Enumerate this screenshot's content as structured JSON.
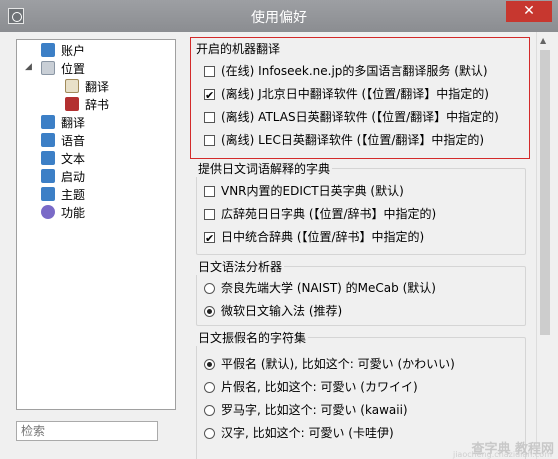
{
  "window": {
    "title": "使用偏好",
    "close": "✕"
  },
  "nav": {
    "items": [
      {
        "label": "账户",
        "icon": "user-icon"
      },
      {
        "label": "位置",
        "icon": "document-icon",
        "expanded": true
      },
      {
        "label": "翻译",
        "icon": "pencil-icon"
      },
      {
        "label": "辞书",
        "icon": "book-icon"
      },
      {
        "label": "翻译",
        "icon": "globe-icon"
      },
      {
        "label": "语音",
        "icon": "music-icon"
      },
      {
        "label": "文本",
        "icon": "text-icon"
      },
      {
        "label": "启动",
        "icon": "play-icon"
      },
      {
        "label": "主题",
        "icon": "palette-icon"
      },
      {
        "label": "功能",
        "icon": "gear-icon"
      }
    ]
  },
  "search": {
    "placeholder": "检索"
  },
  "groups": {
    "machine": {
      "title": "开启的机器翻译",
      "options": [
        {
          "label": "(在线) Infoseek.ne.jp的多国语言翻译服务 (默认)",
          "checked": false
        },
        {
          "label": "(离线) J北京日中翻译软件 (【位置/翻译】中指定的)",
          "checked": true
        },
        {
          "label": "(离线) ATLAS日英翻译软件 (【位置/翻译】中指定的)",
          "checked": false
        },
        {
          "label": "(离线) LEC日英翻译软件 (【位置/翻译】中指定的)",
          "checked": false
        }
      ]
    },
    "dict": {
      "title": "提供日文词语解释的字典",
      "options": [
        {
          "label": "VNR内置的EDICT日英字典 (默认)",
          "checked": false
        },
        {
          "label": "広辞苑日日字典 (【位置/辞书】中指定的)",
          "checked": false
        },
        {
          "label": "日中统合辞典 (【位置/辞书】中指定的)",
          "checked": true
        }
      ]
    },
    "parser": {
      "title": "日文语法分析器",
      "options": [
        {
          "label": "奈良先端大学 (NAIST) 的MeCab (默认)",
          "selected": false
        },
        {
          "label": "微软日文输入法 (推荐)",
          "selected": true
        }
      ]
    },
    "kana": {
      "title": "日文振假名的字符集",
      "options": [
        {
          "label": "平假名 (默认), 比如这个: 可愛い (かわいい)",
          "selected": true
        },
        {
          "label": "片假名, 比如这个: 可愛い (カワイイ)",
          "selected": false
        },
        {
          "label": "罗马字, 比如这个: 可愛い (kawaii)",
          "selected": false
        },
        {
          "label": "汉字, 比如这个: 可愛い (卡哇伊)",
          "selected": false
        }
      ]
    }
  },
  "watermark": {
    "text": "查字典 教程网",
    "sub": "jiaocheng.chazidian.com"
  },
  "colors": {
    "titlebar": "#8b8d91",
    "close": "#c7372f",
    "highlight": "#d32a2a"
  }
}
